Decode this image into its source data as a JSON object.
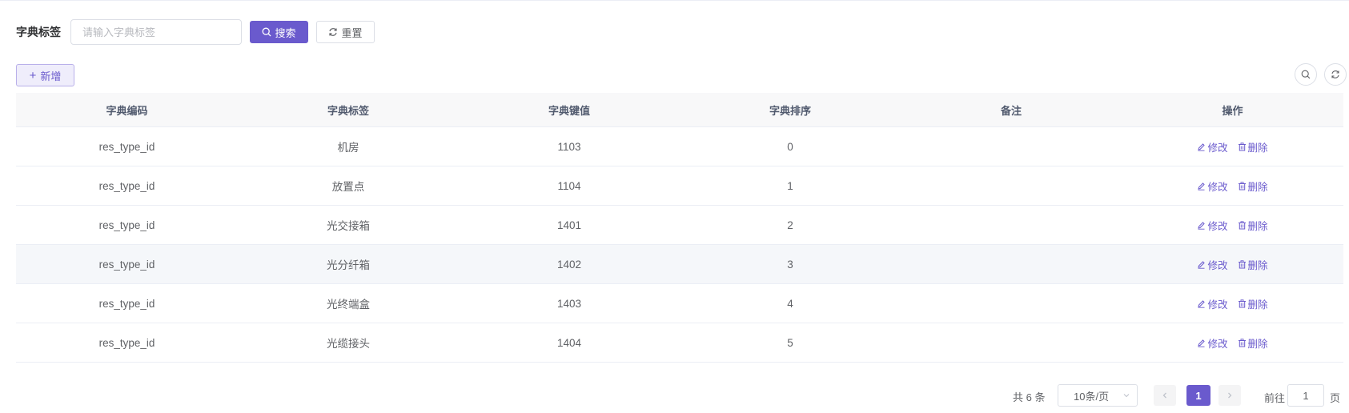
{
  "search": {
    "label": "字典标签",
    "placeholder": "请输入字典标签",
    "value": "",
    "search_button": "搜索",
    "reset_button": "重置"
  },
  "toolbar": {
    "add_button": "新增"
  },
  "table": {
    "columns": [
      "字典编码",
      "字典标签",
      "字典键值",
      "字典排序",
      "备注",
      "操作"
    ],
    "rows": [
      {
        "code": "res_type_id",
        "label": "机房",
        "value": "1103",
        "sort": "0",
        "remark": ""
      },
      {
        "code": "res_type_id",
        "label": "放置点",
        "value": "1104",
        "sort": "1",
        "remark": ""
      },
      {
        "code": "res_type_id",
        "label": "光交接箱",
        "value": "1401",
        "sort": "2",
        "remark": ""
      },
      {
        "code": "res_type_id",
        "label": "光分纤箱",
        "value": "1402",
        "sort": "3",
        "remark": ""
      },
      {
        "code": "res_type_id",
        "label": "光终端盒",
        "value": "1403",
        "sort": "4",
        "remark": ""
      },
      {
        "code": "res_type_id",
        "label": "光缆接头",
        "value": "1404",
        "sort": "5",
        "remark": ""
      }
    ],
    "edit_label": "修改",
    "delete_label": "删除"
  },
  "pagination": {
    "total": "共 6 条",
    "page_size": "10条/页",
    "current_page": "1",
    "goto_label": "前往",
    "goto_value": "1",
    "goto_suffix": "页"
  },
  "colors": {
    "primary": "#6a5acd",
    "header_bg": "#f8f8f9",
    "border": "#ebeef5"
  }
}
